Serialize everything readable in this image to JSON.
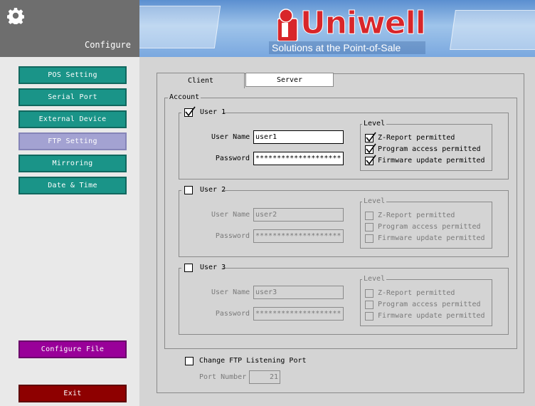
{
  "sidebar": {
    "title": "Configure",
    "items": [
      {
        "label": "POS Setting"
      },
      {
        "label": "Serial Port"
      },
      {
        "label": "External Device"
      },
      {
        "label": "FTP Setting"
      },
      {
        "label": "Mirroring"
      },
      {
        "label": "Date & Time"
      }
    ],
    "configure_file_label": "Configure File",
    "exit_label": "Exit"
  },
  "banner": {
    "logo_text": "Uniwell",
    "tagline": "Solutions at the Point-of-Sale"
  },
  "tabs": [
    {
      "label": "Client"
    },
    {
      "label": "Server"
    }
  ],
  "account": {
    "legend": "Account",
    "users": [
      {
        "label": "User 1",
        "checked": true,
        "user_name_label": "User Name",
        "user_name": "user1",
        "password_label": "Password",
        "password": "********************",
        "level": {
          "legend": "Level",
          "z_report": {
            "label": "Z-Report permitted",
            "checked": true
          },
          "program_access": {
            "label": "Program access permitted",
            "checked": true
          },
          "firmware_update": {
            "label": "Firmware update permitted",
            "checked": true
          }
        }
      },
      {
        "label": "User 2",
        "checked": false,
        "user_name_label": "User Name",
        "user_name": "user2",
        "password_label": "Password",
        "password": "********************",
        "level": {
          "legend": "Level",
          "z_report": {
            "label": "Z-Report permitted",
            "checked": false
          },
          "program_access": {
            "label": "Program access permitted",
            "checked": false
          },
          "firmware_update": {
            "label": "Firmware update permitted",
            "checked": false
          }
        }
      },
      {
        "label": "User 3",
        "checked": false,
        "user_name_label": "User Name",
        "user_name": "user3",
        "password_label": "Password",
        "password": "********************",
        "level": {
          "legend": "Level",
          "z_report": {
            "label": "Z-Report permitted",
            "checked": false
          },
          "program_access": {
            "label": "Program access permitted",
            "checked": false
          },
          "firmware_update": {
            "label": "Firmware update permitted",
            "checked": false
          }
        }
      }
    ]
  },
  "ftp_port": {
    "change_label": "Change FTP Listening Port",
    "checked": false,
    "port_label": "Port Number",
    "port_value": "21"
  },
  "colors": {
    "nav_teal": "#1a9488",
    "nav_active": "#a3a2d2",
    "configure_file": "#990099",
    "exit": "#8e0000",
    "brand_red": "#d8262a"
  }
}
